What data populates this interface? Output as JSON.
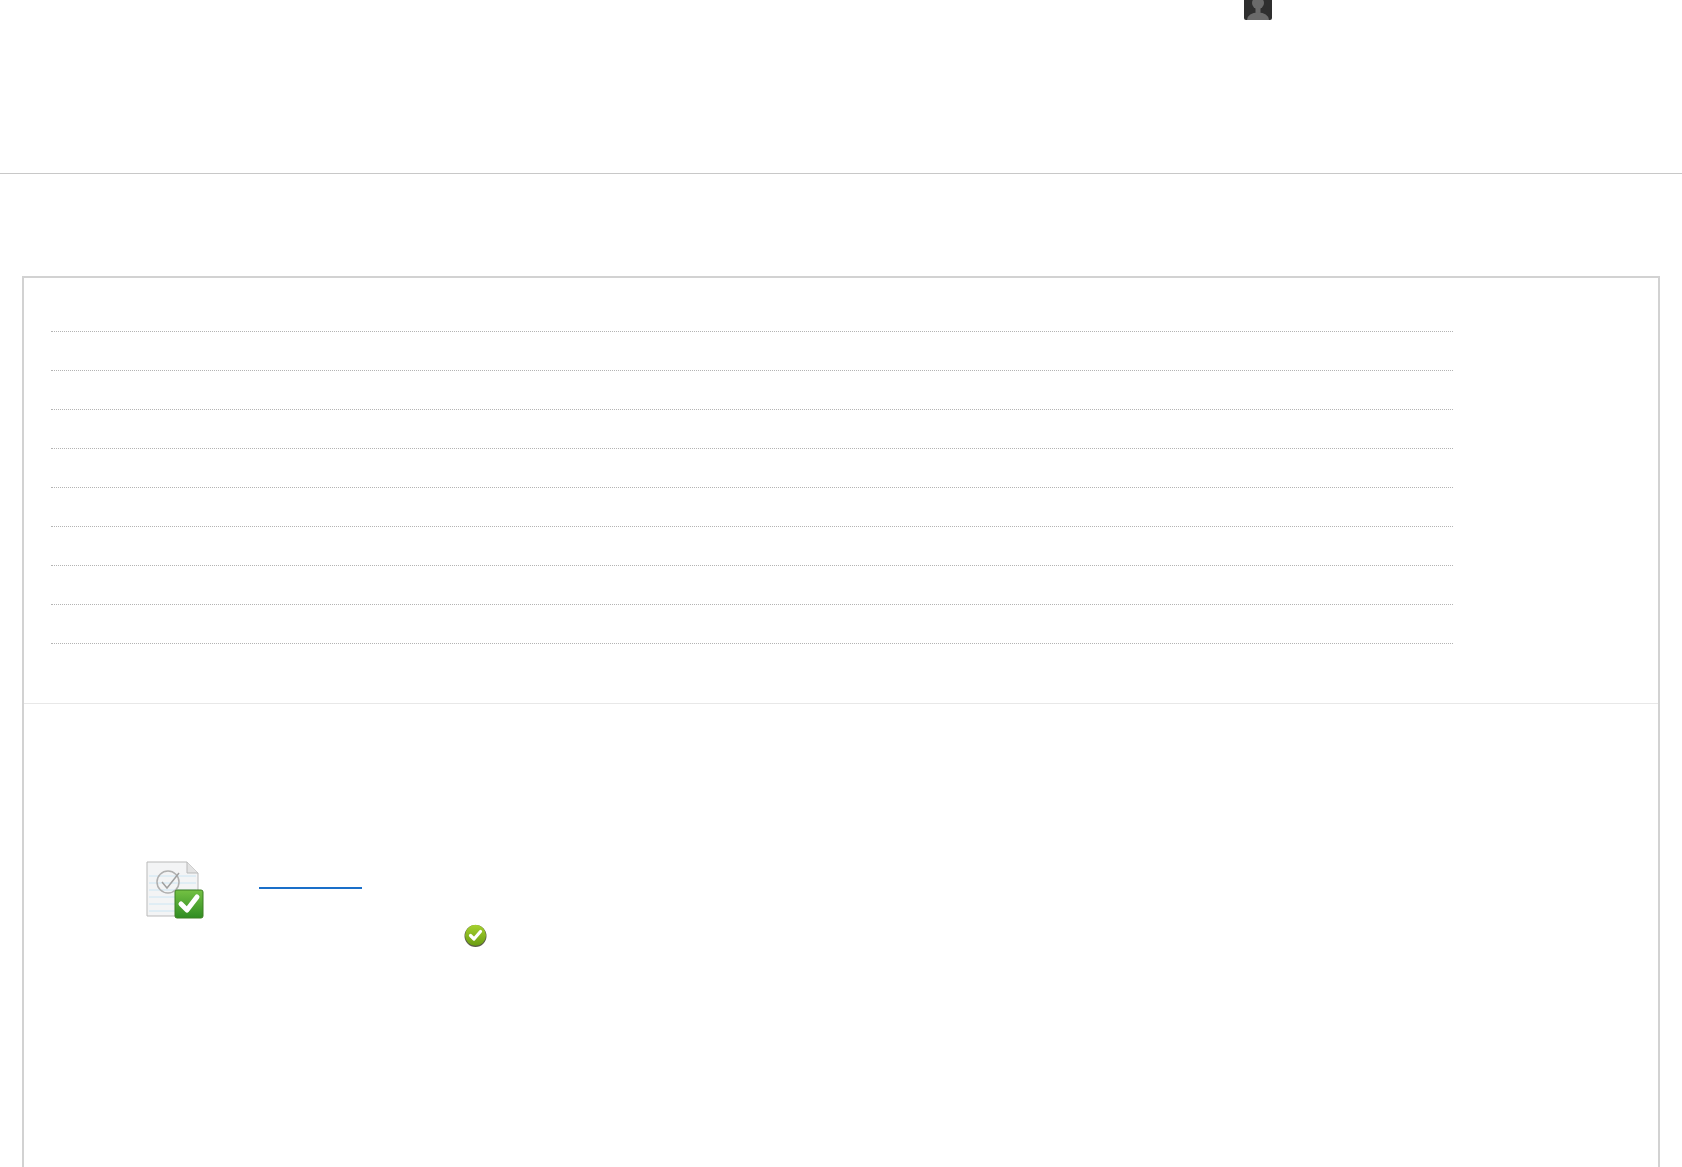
{
  "list": {
    "rows": [
      {
        "kind": "blank"
      },
      {
        "kind": "blank"
      },
      {
        "kind": "blank"
      },
      {
        "kind": "blank"
      },
      {
        "kind": "blank"
      },
      {
        "kind": "blank"
      },
      {
        "kind": "blank"
      },
      {
        "kind": "blank"
      },
      {
        "kind": "blank"
      }
    ]
  },
  "item": {
    "complete": true
  }
}
